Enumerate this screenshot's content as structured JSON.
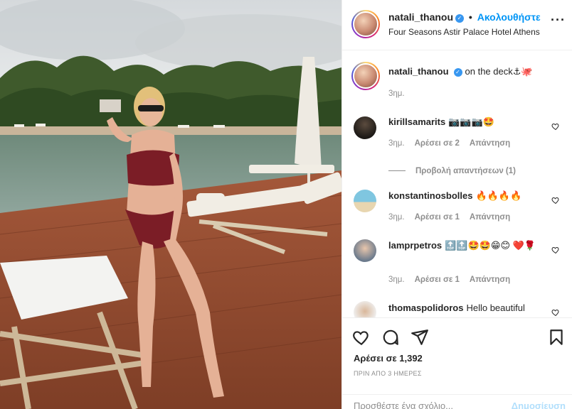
{
  "header": {
    "username": "natali_thanou",
    "separator": "•",
    "follow_label": "Ακολουθήστε",
    "location": "Four Seasons Astir Palace Hotel Athens",
    "more_icon": "ellipsis-icon"
  },
  "caption": {
    "username": "natali_thanou",
    "text": "on the deck⚓🐙",
    "time": "3ημ."
  },
  "comments": [
    {
      "username": "kirillsamarits",
      "text": "📷📷📷🤩",
      "time": "3ημ.",
      "likes": "Αρέσει σε 2",
      "reply": "Απάντηση"
    },
    {
      "username": "konstantinosbolles",
      "text": "🔥🔥🔥🔥",
      "time": "3ημ.",
      "likes": "Αρέσει σε 1",
      "reply": "Απάντηση"
    },
    {
      "username": "lamprpetros",
      "text": "🔝🔝🤩🤩😁😊 ❤️🌹",
      "time": "3ημ.",
      "likes": "Αρέσει σε 1",
      "reply": "Απάντηση"
    },
    {
      "username": "thomaspolidoros",
      "text": "Hello beautiful"
    }
  ],
  "view_replies": "Προβολή απαντήσεων (1)",
  "actions": {
    "likes": "Αρέσει σε 1,392",
    "time": "ΠΡΙΝ ΑΠΟ 3 ΗΜΕΡΕΣ"
  },
  "add_comment": {
    "placeholder": "Προσθέστε ένα σχόλιο...",
    "post_label": "Δημοσίευση"
  },
  "colors": {
    "accent": "#0095f6",
    "verified": "#3897f0",
    "muted": "#8e8e8e"
  }
}
